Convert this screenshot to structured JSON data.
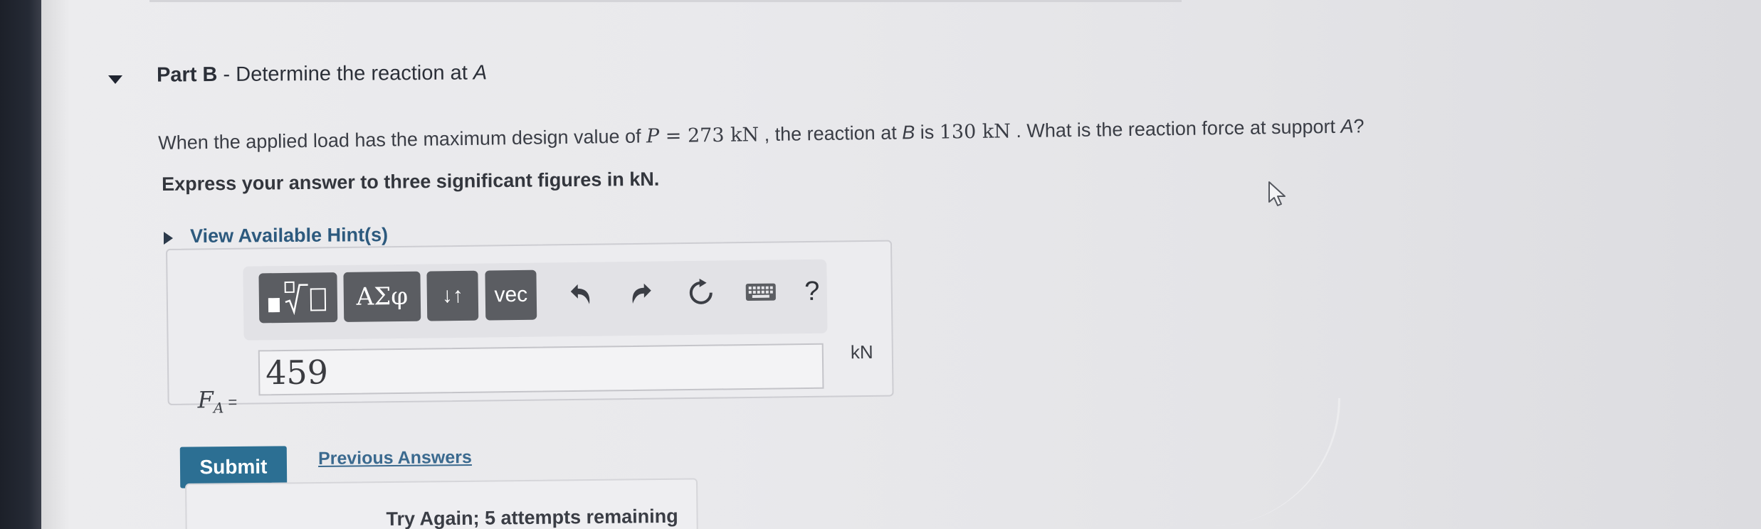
{
  "part": {
    "label": "Part B",
    "separator": " - ",
    "title_prefix": "Determine the reaction at ",
    "title_var": "A"
  },
  "question": {
    "text1": "When the applied load has the maximum design value of ",
    "load_var": "P",
    "load_eq": " = 273 kN",
    "text2": " , the reaction at ",
    "reaction_point": "B",
    "text3": " is ",
    "reaction_value": "130 kN",
    "text4": " . What is the reaction force at support ",
    "support_var": "A",
    "text5": "?"
  },
  "instruction": "Express your answer to three significant figures in kN.",
  "hints": {
    "label": "View Available Hint(s)"
  },
  "toolbar": {
    "templates_icon": "templates-radical-icon",
    "greek_label": "ΑΣφ",
    "arrows_label": "↓↑",
    "vec_label": "vec",
    "undo_icon": "undo-icon",
    "redo_icon": "redo-icon",
    "reset_icon": "reset-icon",
    "keyboard_icon": "keyboard-icon",
    "help_label": "?"
  },
  "answer": {
    "var": "F",
    "sub": "A",
    "equals": " =",
    "value": "459",
    "unit": "kN"
  },
  "actions": {
    "submit_label": "Submit",
    "previous_label": "Previous Answers"
  },
  "feedback": {
    "text": "Try Again; 5 attempts remaining"
  },
  "colors": {
    "submit_bg": "#2c6f93",
    "link": "#2d5a7e",
    "toolbar_button": "#5b5d62"
  }
}
